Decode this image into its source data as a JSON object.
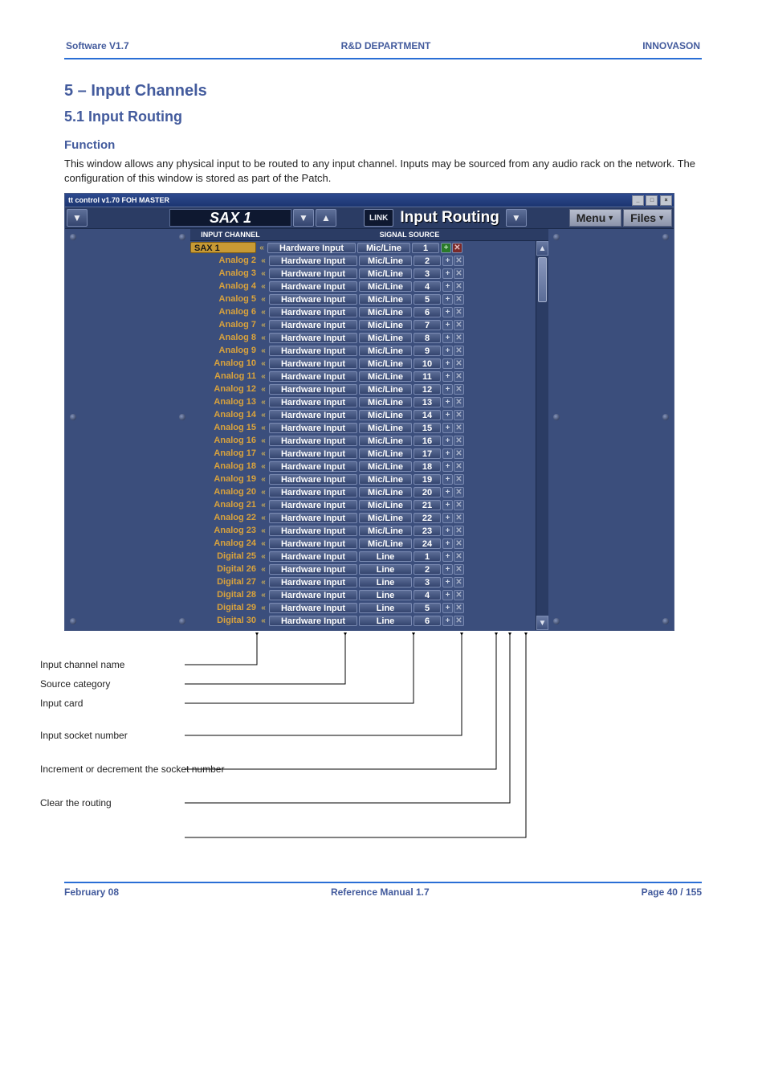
{
  "header": {
    "left": "Software V1.7",
    "center": "R&D DEPARTMENT",
    "right": "INNOVASON"
  },
  "section": "5 – Input Channels",
  "subsection": "5.1   Input Routing",
  "func_title": "Function",
  "body_text": "This window allows any physical input to be routed to any input channel. Inputs may be sourced from any audio rack on the network. The configuration of this window is stored as part of the Patch.",
  "window": {
    "titlebar": "tt control  v1.70 FOH MASTER",
    "channel": "SAX 1",
    "link_btn": "LINK",
    "routing_label": "Input Routing",
    "menu_btn": "Menu",
    "files_btn": "Files",
    "col_input": "INPUT CHANNEL",
    "col_source": "SIGNAL SOURCE",
    "rows": [
      {
        "name": "SAX 1",
        "selected": true,
        "hw": "Hardware Input",
        "ml": "Mic/Line",
        "num": "1",
        "bold": true
      },
      {
        "name": "Analog 2",
        "selected": false,
        "hw": "Hardware Input",
        "ml": "Mic/Line",
        "num": "2",
        "bold": false
      },
      {
        "name": "Analog 3",
        "selected": false,
        "hw": "Hardware Input",
        "ml": "Mic/Line",
        "num": "3",
        "bold": false
      },
      {
        "name": "Analog 4",
        "selected": false,
        "hw": "Hardware Input",
        "ml": "Mic/Line",
        "num": "4",
        "bold": false
      },
      {
        "name": "Analog 5",
        "selected": false,
        "hw": "Hardware Input",
        "ml": "Mic/Line",
        "num": "5",
        "bold": false
      },
      {
        "name": "Analog 6",
        "selected": false,
        "hw": "Hardware Input",
        "ml": "Mic/Line",
        "num": "6",
        "bold": false
      },
      {
        "name": "Analog 7",
        "selected": false,
        "hw": "Hardware Input",
        "ml": "Mic/Line",
        "num": "7",
        "bold": false
      },
      {
        "name": "Analog 8",
        "selected": false,
        "hw": "Hardware Input",
        "ml": "Mic/Line",
        "num": "8",
        "bold": false
      },
      {
        "name": "Analog 9",
        "selected": false,
        "hw": "Hardware Input",
        "ml": "Mic/Line",
        "num": "9",
        "bold": false
      },
      {
        "name": "Analog 10",
        "selected": false,
        "hw": "Hardware Input",
        "ml": "Mic/Line",
        "num": "10",
        "bold": false
      },
      {
        "name": "Analog 11",
        "selected": false,
        "hw": "Hardware Input",
        "ml": "Mic/Line",
        "num": "11",
        "bold": false
      },
      {
        "name": "Analog 12",
        "selected": false,
        "hw": "Hardware Input",
        "ml": "Mic/Line",
        "num": "12",
        "bold": false
      },
      {
        "name": "Analog 13",
        "selected": false,
        "hw": "Hardware Input",
        "ml": "Mic/Line",
        "num": "13",
        "bold": false
      },
      {
        "name": "Analog 14",
        "selected": false,
        "hw": "Hardware Input",
        "ml": "Mic/Line",
        "num": "14",
        "bold": false
      },
      {
        "name": "Analog 15",
        "selected": false,
        "hw": "Hardware Input",
        "ml": "Mic/Line",
        "num": "15",
        "bold": false
      },
      {
        "name": "Analog 16",
        "selected": false,
        "hw": "Hardware Input",
        "ml": "Mic/Line",
        "num": "16",
        "bold": false
      },
      {
        "name": "Analog 17",
        "selected": false,
        "hw": "Hardware Input",
        "ml": "Mic/Line",
        "num": "17",
        "bold": false
      },
      {
        "name": "Analog 18",
        "selected": false,
        "hw": "Hardware Input",
        "ml": "Mic/Line",
        "num": "18",
        "bold": false
      },
      {
        "name": "Analog 19",
        "selected": false,
        "hw": "Hardware Input",
        "ml": "Mic/Line",
        "num": "19",
        "bold": false
      },
      {
        "name": "Analog 20",
        "selected": false,
        "hw": "Hardware Input",
        "ml": "Mic/Line",
        "num": "20",
        "bold": false
      },
      {
        "name": "Analog 21",
        "selected": false,
        "hw": "Hardware Input",
        "ml": "Mic/Line",
        "num": "21",
        "bold": false
      },
      {
        "name": "Analog 22",
        "selected": false,
        "hw": "Hardware Input",
        "ml": "Mic/Line",
        "num": "22",
        "bold": false
      },
      {
        "name": "Analog 23",
        "selected": false,
        "hw": "Hardware Input",
        "ml": "Mic/Line",
        "num": "23",
        "bold": false
      },
      {
        "name": "Analog 24",
        "selected": false,
        "hw": "Hardware Input",
        "ml": "Mic/Line",
        "num": "24",
        "bold": false
      },
      {
        "name": "Digital 25",
        "selected": false,
        "hw": "Hardware Input",
        "ml": "Line",
        "num": "1",
        "bold": false
      },
      {
        "name": "Digital 26",
        "selected": false,
        "hw": "Hardware Input",
        "ml": "Line",
        "num": "2",
        "bold": false
      },
      {
        "name": "Digital 27",
        "selected": false,
        "hw": "Hardware Input",
        "ml": "Line",
        "num": "3",
        "bold": false
      },
      {
        "name": "Digital 28",
        "selected": false,
        "hw": "Hardware Input",
        "ml": "Line",
        "num": "4",
        "bold": false
      },
      {
        "name": "Digital 29",
        "selected": false,
        "hw": "Hardware Input",
        "ml": "Line",
        "num": "5",
        "bold": false
      },
      {
        "name": "Digital 30",
        "selected": false,
        "hw": "Hardware Input",
        "ml": "Line",
        "num": "6",
        "bold": false
      }
    ]
  },
  "callouts": [
    "Input channel name",
    "Source category",
    "Input card",
    "Input socket number",
    "Increment or decrement the socket number",
    "Clear the routing"
  ],
  "footer": {
    "left": "February 08",
    "center": "Reference Manual 1.7",
    "right": "Page 40 / 155"
  }
}
